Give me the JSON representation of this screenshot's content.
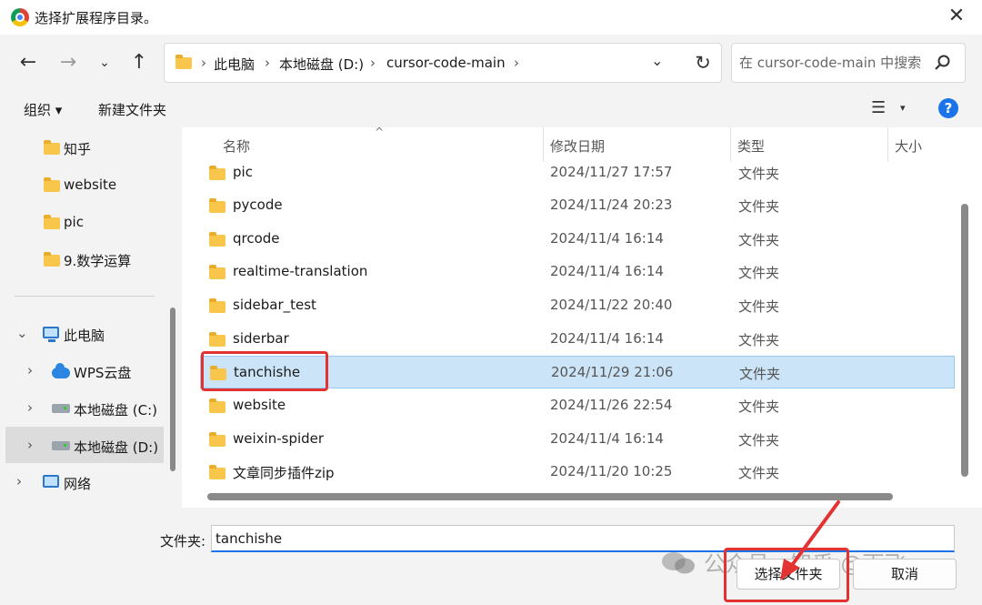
{
  "window": {
    "title": "选择扩展程序目录。",
    "close_glyph": "✕"
  },
  "nav": {
    "back_glyph": "←",
    "forward_glyph": "→",
    "recent_glyph": "⌄",
    "up_glyph": "↑",
    "refresh_glyph": "↻",
    "dropdown_glyph": "⌄",
    "breadcrumb": [
      "此电脑",
      "本地磁盘 (D:)",
      "cursor-code-main"
    ],
    "separator": "›"
  },
  "search": {
    "placeholder": "在 cursor-code-main 中搜索"
  },
  "toolbar": {
    "organize_label": "组织 ▾",
    "new_folder_label": "新建文件夹",
    "view_glyph": "☰",
    "view_caret": "▾",
    "help_glyph": "?"
  },
  "sidebar": {
    "quick_items": [
      {
        "label": "知乎",
        "icon": "folder-icon"
      },
      {
        "label": "website",
        "icon": "folder-icon"
      },
      {
        "label": "pic",
        "icon": "folder-icon"
      },
      {
        "label": "9.数学运算",
        "icon": "folder-icon"
      }
    ],
    "tree": [
      {
        "label": "此电脑",
        "icon": "computer-icon",
        "expander": "⌄"
      },
      {
        "label": "WPS云盘",
        "icon": "cloud-icon",
        "expander": "›"
      },
      {
        "label": "本地磁盘 (C:)",
        "icon": "drive-icon",
        "expander": "›"
      },
      {
        "label": "本地磁盘 (D:)",
        "icon": "drive-icon",
        "expander": "›",
        "selected": true
      },
      {
        "label": "网络",
        "icon": "network-icon",
        "expander": "›"
      }
    ]
  },
  "columns": {
    "name": "名称",
    "modified": "修改日期",
    "type": "类型",
    "size": "大小",
    "sort_glyph": "^"
  },
  "files": [
    {
      "name": "pic",
      "modified": "2024/11/27 17:57",
      "type": "文件夹"
    },
    {
      "name": "pycode",
      "modified": "2024/11/24 20:23",
      "type": "文件夹"
    },
    {
      "name": "qrcode",
      "modified": "2024/11/4 16:14",
      "type": "文件夹"
    },
    {
      "name": "realtime-translation",
      "modified": "2024/11/4 16:14",
      "type": "文件夹"
    },
    {
      "name": "sidebar_test",
      "modified": "2024/11/22 20:40",
      "type": "文件夹"
    },
    {
      "name": "siderbar",
      "modified": "2024/11/4 16:14",
      "type": "文件夹"
    },
    {
      "name": "tanchishe",
      "modified": "2024/11/29 21:06",
      "type": "文件夹",
      "selected": true
    },
    {
      "name": "website",
      "modified": "2024/11/26 22:54",
      "type": "文件夹"
    },
    {
      "name": "weixin-spider",
      "modified": "2024/11/4 16:14",
      "type": "文件夹"
    },
    {
      "name": "文章同步插件zip",
      "modified": "2024/11/20 10:25",
      "type": "文件夹"
    }
  ],
  "footer": {
    "folder_label": "文件夹:",
    "folder_value": "tanchishe",
    "select_button": "选择文件夹",
    "cancel_button": "取消",
    "watermark": "公众号 · 知乎 @雨飞"
  },
  "colors": {
    "accent": "#1a73e8",
    "selection": "#cce4f7",
    "annotation": "#e23232",
    "folder": "#f9c64c"
  }
}
